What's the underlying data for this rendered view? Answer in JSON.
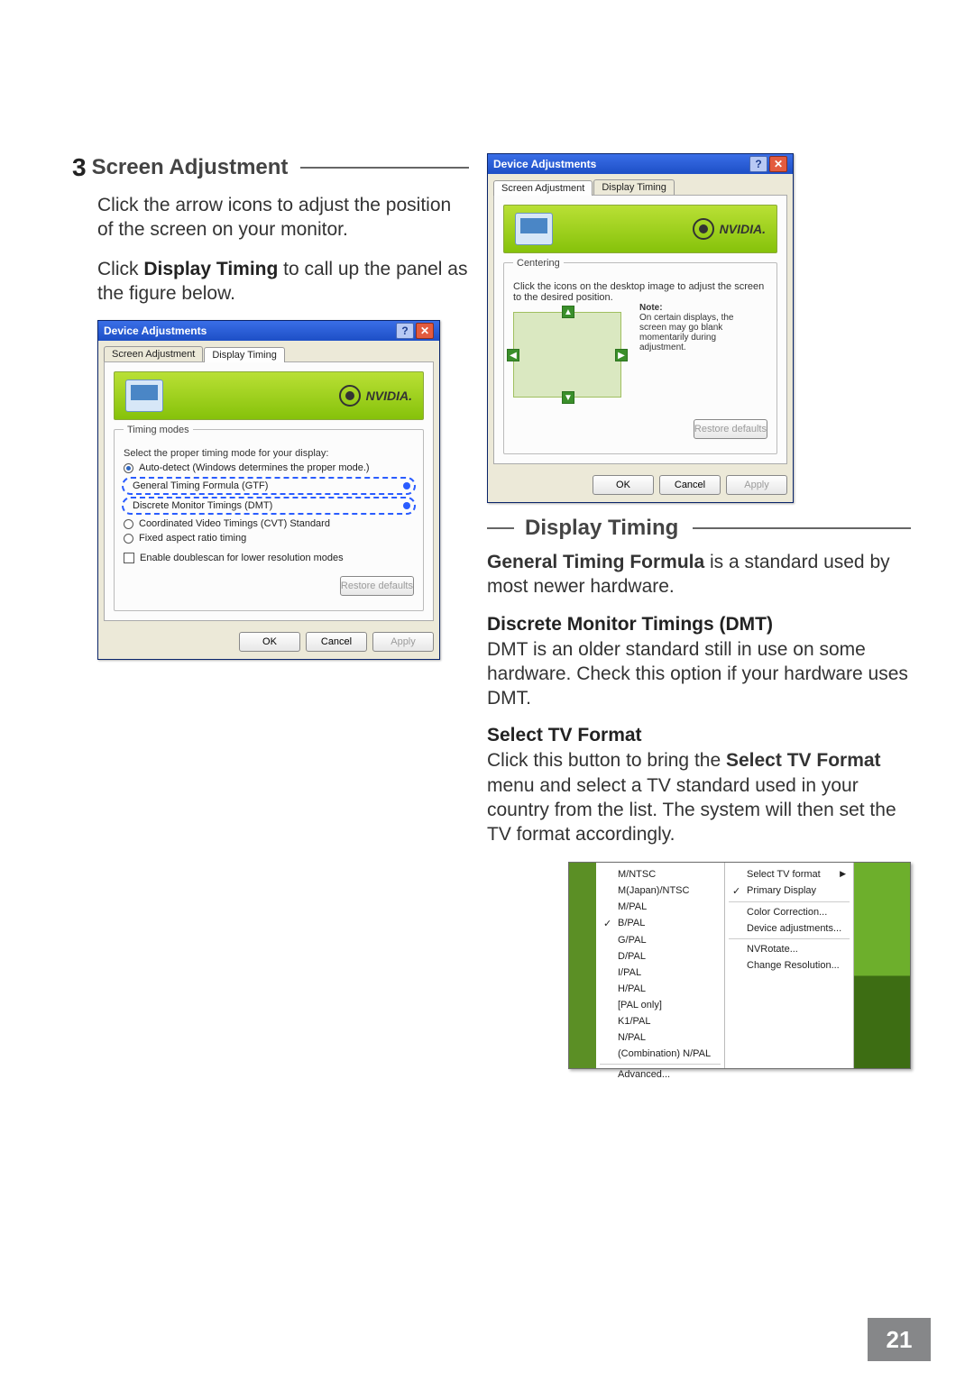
{
  "page_number": "21",
  "section3": {
    "num": "3",
    "title": "Screen Adjustment",
    "p1a": "Click the arrow icons to adjust the position of the screen on your monitor.",
    "p2a": "Click ",
    "p2b": "Display Timing",
    "p2c": " to call up the panel as the figure below."
  },
  "dlg_left": {
    "title": "Device Adjustments",
    "tab1": "Screen Adjustment",
    "tab2": "Display Timing",
    "group": "Timing modes",
    "groupintro": "Select the proper timing mode for your display:",
    "r1": "Auto-detect (Windows determines the proper mode.)",
    "r2": "General Timing Formula (GTF)",
    "r3": "Discrete Monitor Timings (DMT)",
    "r4": "Coordinated Video Timings (CVT) Standard",
    "r5": "Fixed aspect ratio timing",
    "chk": "Enable doublescan for lower resolution modes",
    "restore": "Restore defaults",
    "ok": "OK",
    "cancel": "Cancel",
    "apply": "Apply",
    "brand": "NVIDIA."
  },
  "dlg_right": {
    "title": "Device Adjustments",
    "tab1": "Screen Adjustment",
    "tab2": "Display Timing",
    "group": "Centering",
    "intro": "Click the icons on the desktop image to adjust the screen to the desired position.",
    "note_h": "Note:",
    "note": "On certain displays, the screen may go blank momentarily during adjustment.",
    "restore": "Restore defaults",
    "ok": "OK",
    "cancel": "Cancel",
    "apply": "Apply",
    "brand": "NVIDIA."
  },
  "display_timing": {
    "heading": "Display Timing",
    "gtf_h": "General Timing Formula",
    "gtf_t": " is a standard used by most newer hardware.",
    "dmt_h": "Discrete Monitor Timings (DMT)",
    "dmt_t": "DMT is an older standard still in use on some hardware. Check this option if your hardware uses DMT.",
    "tv_h": "Select TV Format",
    "tv_p1": "Click this button to bring the ",
    "tv_p2": "Select TV Format",
    "tv_p3": " menu and select a TV standard used in your country from the list. The system will then set the TV format accordingly."
  },
  "menu": {
    "fmt": [
      "M/NTSC",
      "M(Japan)/NTSC",
      "M/PAL",
      "B/PAL",
      "G/PAL",
      "D/PAL",
      "I/PAL",
      "H/PAL",
      "[PAL only]",
      "K1/PAL",
      "N/PAL",
      "(Combination) N/PAL",
      "Advanced..."
    ],
    "selected_index": 3,
    "right": [
      "Select TV format",
      "Primary Display",
      "Color Correction...",
      "Device adjustments...",
      "NVRotate...",
      "Change Resolution..."
    ],
    "right_checked_index": 1
  }
}
